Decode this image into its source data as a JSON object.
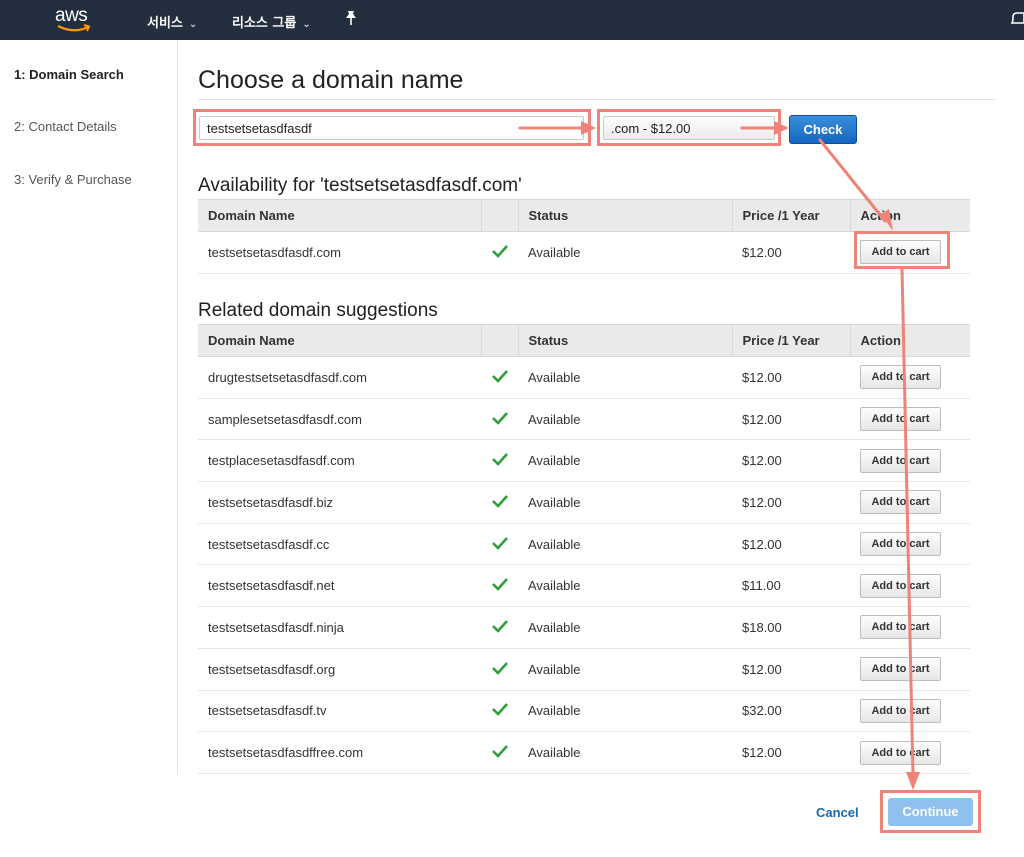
{
  "nav": {
    "logo": "aws",
    "services": "서비스",
    "resource_groups": "리소스 그룹",
    "pin_icon": "pin-icon",
    "bell_icon": "bell-icon",
    "colors": {
      "background": "#232f3e",
      "logo_smile": "#ff9900"
    }
  },
  "sidebar": {
    "steps": [
      {
        "label": "1: Domain Search",
        "active": true
      },
      {
        "label": "2: Contact Details",
        "active": false
      },
      {
        "label": "3: Verify & Purchase",
        "active": false
      }
    ]
  },
  "main": {
    "title": "Choose a domain name",
    "search": {
      "value": "testsetsetasdfasdf"
    },
    "tld_select": {
      "selected": ".com - $12.00"
    },
    "check_button": "Check",
    "availability": {
      "title": "Availability for 'testsetsetasdfasdf.com'",
      "columns": [
        "Domain Name",
        "",
        "Status",
        "Price /1 Year",
        "Action"
      ],
      "rows": [
        {
          "domain": "testsetsetasdfasdf.com",
          "status": "Available",
          "price": "$12.00",
          "action": "Add to cart"
        }
      ]
    },
    "related": {
      "title": "Related domain suggestions",
      "columns": [
        "Domain Name",
        "",
        "Status",
        "Price /1 Year",
        "Action"
      ],
      "rows": [
        {
          "domain": "drugtestsetsetasdfasdf.com",
          "status": "Available",
          "price": "$12.00",
          "action": "Add to cart"
        },
        {
          "domain": "samplesetsetasdfasdf.com",
          "status": "Available",
          "price": "$12.00",
          "action": "Add to cart"
        },
        {
          "domain": "testplacesetasdfasdf.com",
          "status": "Available",
          "price": "$12.00",
          "action": "Add to cart"
        },
        {
          "domain": "testsetsetasdfasdf.biz",
          "status": "Available",
          "price": "$12.00",
          "action": "Add to cart"
        },
        {
          "domain": "testsetsetasdfasdf.cc",
          "status": "Available",
          "price": "$12.00",
          "action": "Add to cart"
        },
        {
          "domain": "testsetsetasdfasdf.net",
          "status": "Available",
          "price": "$11.00",
          "action": "Add to cart"
        },
        {
          "domain": "testsetsetasdfasdf.ninja",
          "status": "Available",
          "price": "$18.00",
          "action": "Add to cart"
        },
        {
          "domain": "testsetsetasdfasdf.org",
          "status": "Available",
          "price": "$12.00",
          "action": "Add to cart"
        },
        {
          "domain": "testsetsetasdfasdf.tv",
          "status": "Available",
          "price": "$32.00",
          "action": "Add to cart"
        },
        {
          "domain": "testsetsetasdfasdffree.com",
          "status": "Available",
          "price": "$12.00",
          "action": "Add to cart"
        }
      ]
    },
    "status_icon": "check-icon",
    "footer": {
      "cancel": "Cancel",
      "continue": "Continue"
    }
  },
  "colors": {
    "annotation": "#f08378",
    "primary_button": "#1565c0",
    "disabled_button": "#8fc0ee",
    "available_check": "#2e9e3e",
    "link": "#1a66b8"
  }
}
